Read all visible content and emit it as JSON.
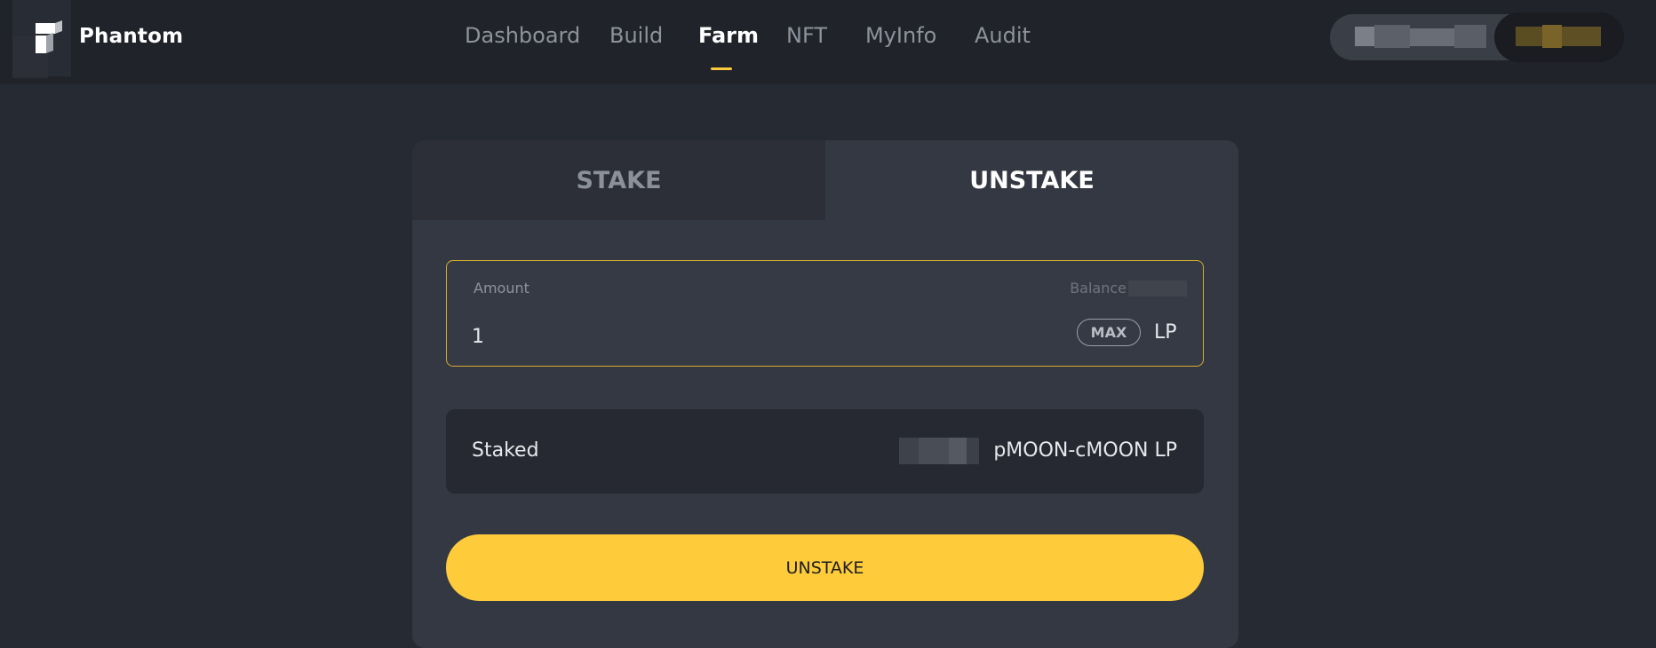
{
  "header": {
    "brand": "Phantom",
    "nav": [
      {
        "label": "Dashboard"
      },
      {
        "label": "Build"
      },
      {
        "label": "Farm",
        "active": true
      },
      {
        "label": "NFT"
      },
      {
        "label": "MyInfo"
      },
      {
        "label": "Audit"
      }
    ]
  },
  "card": {
    "tabs": [
      {
        "label": "STAKE"
      },
      {
        "label": "UNSTAKE",
        "active": true
      }
    ],
    "amount": {
      "label": "Amount",
      "balance_label": "Balance",
      "value": "1",
      "max_label": "MAX",
      "unit": "LP"
    },
    "staked": {
      "label": "Staked",
      "value_suffix": "pMOON-cMOON LP"
    },
    "action_label": "UNSTAKE"
  },
  "colors": {
    "accent": "#fecb3b",
    "background": "#262a32",
    "card": "#343842",
    "header": "#20232a"
  }
}
